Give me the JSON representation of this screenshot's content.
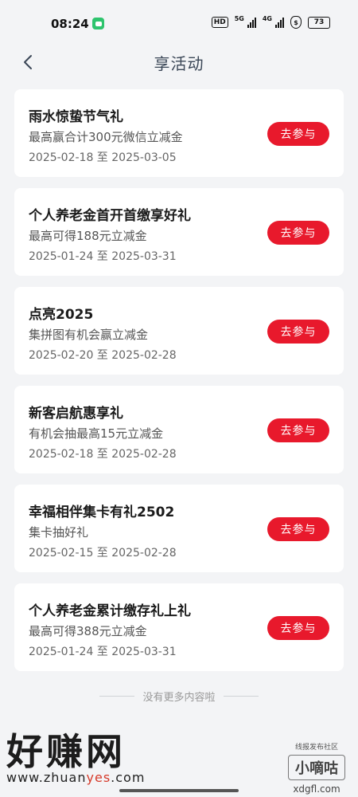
{
  "status_bar": {
    "time": "08:24",
    "hd_label": "HD",
    "net_5g": "5G",
    "net_4g": "4G",
    "shield_symbol": "$",
    "battery": "73"
  },
  "header": {
    "title": "享活动",
    "back_icon": "chevron-left-icon"
  },
  "activities": [
    {
      "title": "雨水惊蛰节气礼",
      "desc": "最高赢合计300元微信立减金",
      "date": "2025-02-18 至 2025-03-05",
      "button": "去参与"
    },
    {
      "title": "个人养老金首开首缴享好礼",
      "desc": "最高可得188元立减金",
      "date": "2025-01-24 至 2025-03-31",
      "button": "去参与"
    },
    {
      "title": "点亮2025",
      "desc": "集拼图有机会赢立减金",
      "date": "2025-02-20 至 2025-02-28",
      "button": "去参与"
    },
    {
      "title": "新客启航惠享礼",
      "desc": "有机会抽最高15元立减金",
      "date": "2025-02-18 至 2025-02-28",
      "button": "去参与"
    },
    {
      "title": "幸福相伴集卡有礼2502",
      "desc": "集卡抽好礼",
      "date": "2025-02-15 至 2025-02-28",
      "button": "去参与"
    },
    {
      "title": "个人养老金累计缴存礼上礼",
      "desc": "最高可得388元立减金",
      "date": "2025-01-24 至 2025-03-31",
      "button": "去参与"
    }
  ],
  "footer": {
    "end_text": "没有更多内容啦"
  },
  "watermark": {
    "left_big": "好赚网",
    "left_url_prefix": "www.zhuan",
    "left_url_mid": "yes",
    "left_url_suffix": ".com",
    "right_small": "线报发布社区",
    "right_box": "小嘀咕",
    "right_site": "xdgfl.com"
  },
  "colors": {
    "accent": "#e8192c",
    "background": "#f3f4f6",
    "card": "#ffffff",
    "title": "#3a4656"
  }
}
